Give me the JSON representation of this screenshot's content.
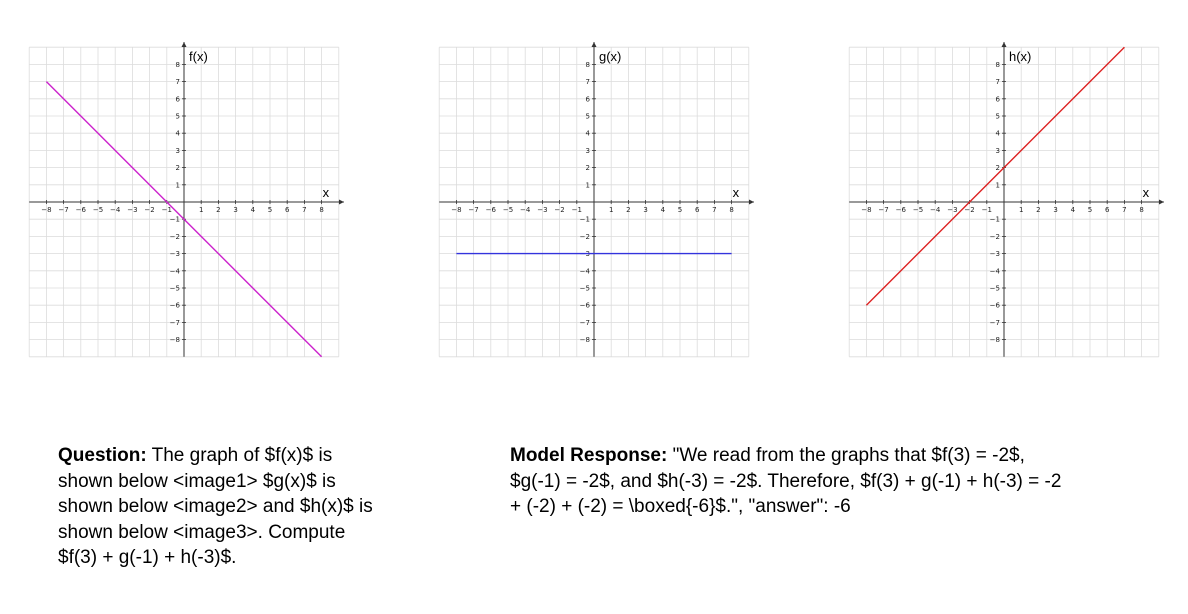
{
  "chart_data": [
    {
      "type": "line",
      "name": "f",
      "ylabel": "f(x)",
      "xlabel": "x",
      "xlim": [
        -9,
        9
      ],
      "ylim": [
        -9,
        9
      ],
      "xticks": [
        -8,
        -7,
        -6,
        -5,
        -4,
        -3,
        -2,
        -1,
        1,
        2,
        3,
        4,
        5,
        6,
        7,
        8
      ],
      "yticks": [
        -8,
        -7,
        -6,
        -5,
        -4,
        -3,
        -2,
        -1,
        1,
        2,
        3,
        4,
        5,
        6,
        7,
        8
      ],
      "grid": true,
      "series": [
        {
          "x": [
            -8,
            8
          ],
          "y": [
            7,
            -9
          ],
          "color": "#cc22cc"
        }
      ]
    },
    {
      "type": "line",
      "name": "g",
      "ylabel": "g(x)",
      "xlabel": "x",
      "xlim": [
        -9,
        9
      ],
      "ylim": [
        -9,
        9
      ],
      "xticks": [
        -8,
        -7,
        -6,
        -5,
        -4,
        -3,
        -2,
        -1,
        1,
        2,
        3,
        4,
        5,
        6,
        7,
        8
      ],
      "yticks": [
        -8,
        -7,
        -6,
        -5,
        -4,
        -3,
        -2,
        -1,
        1,
        2,
        3,
        4,
        5,
        6,
        7,
        8
      ],
      "grid": true,
      "series": [
        {
          "x": [
            -8,
            8
          ],
          "y": [
            -3,
            -3
          ],
          "color": "#3333dd"
        }
      ]
    },
    {
      "type": "line",
      "name": "h",
      "ylabel": "h(x)",
      "xlabel": "x",
      "xlim": [
        -9,
        9
      ],
      "ylim": [
        -9,
        9
      ],
      "xticks": [
        -8,
        -7,
        -6,
        -5,
        -4,
        -3,
        -2,
        -1,
        1,
        2,
        3,
        4,
        5,
        6,
        7,
        8
      ],
      "yticks": [
        -8,
        -7,
        -6,
        -5,
        -4,
        -3,
        -2,
        -1,
        1,
        2,
        3,
        4,
        5,
        6,
        7,
        8
      ],
      "grid": true,
      "series": [
        {
          "x": [
            -8,
            7
          ],
          "y": [
            -6,
            9
          ],
          "color": "#dd2222"
        }
      ]
    }
  ],
  "question": {
    "label": "Question:",
    "text": " The graph of $f(x)$ is shown below <image1> $g(x)$ is shown below <image2> and $h(x)$ is shown below <image3>. Compute $f(3) + g(-1) + h(-3)$."
  },
  "response": {
    "label": "Model Response:",
    "text": " \"We read from the graphs that $f(3) = -2$, $g(-1) = -2$, and $h(-3) = -2$. Therefore, $f(3) + g(-1) + h(-3) = -2 + (-2) + (-2) = \\boxed{-6}$.\", \"answer\": -6"
  }
}
